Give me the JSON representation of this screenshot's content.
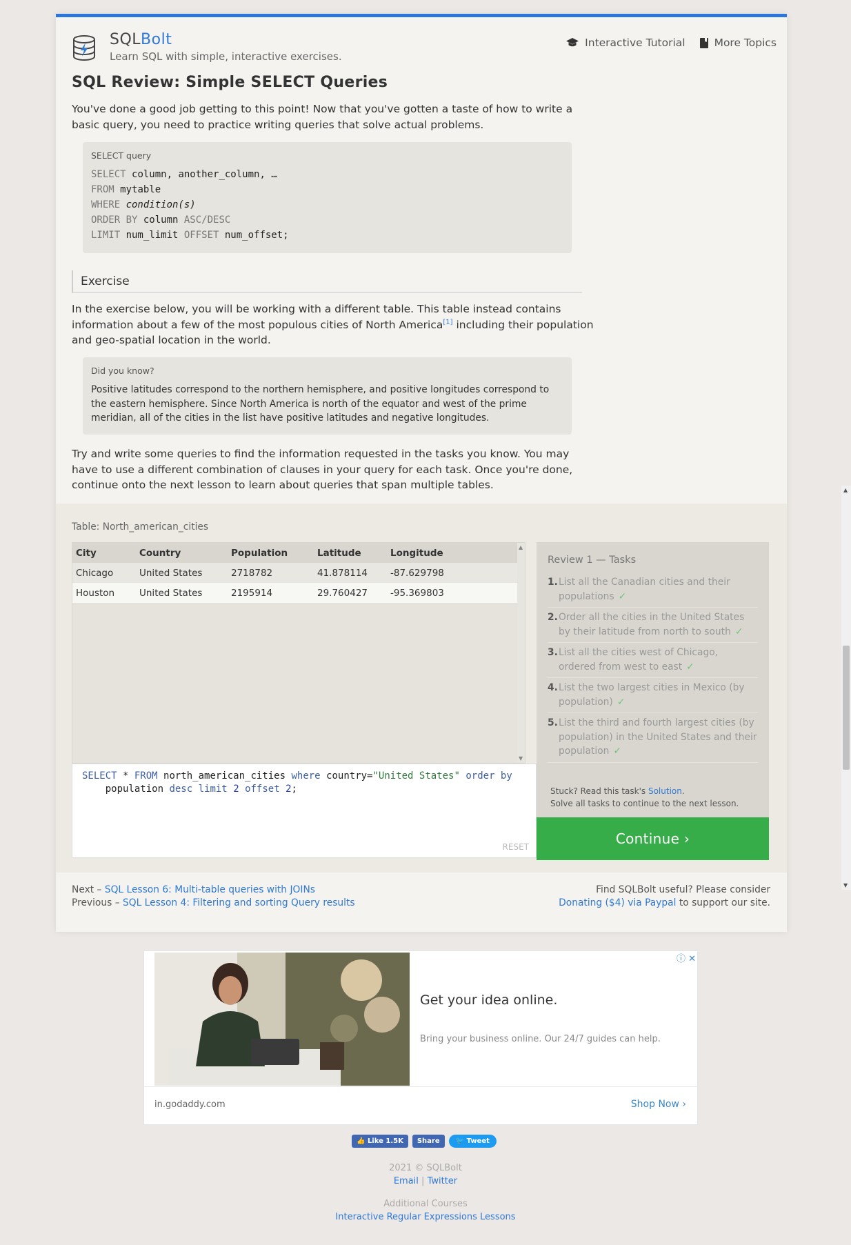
{
  "header": {
    "brand_prefix": "SQL",
    "brand_suffix": "Bolt",
    "tagline": "Learn SQL with simple, interactive exercises.",
    "nav": [
      {
        "label": "Interactive Tutorial",
        "icon": "graduation-cap-icon"
      },
      {
        "label": "More Topics",
        "icon": "bookmark-icon"
      }
    ]
  },
  "lesson": {
    "title": "SQL Review: Simple SELECT Queries",
    "intro": "You've done a good job getting to this point! Now that you've gotten a taste of how to write a basic query, you need to practice writing queries that solve actual problems.",
    "query_box_label": "SELECT query",
    "query_lines": [
      {
        "kw": "SELECT ",
        "rest": "column, another_column, …"
      },
      {
        "kw": "FROM ",
        "rest": "mytable"
      },
      {
        "kw": "WHERE ",
        "rest": "condition(s)"
      },
      {
        "kw": "ORDER BY ",
        "rest": "column",
        "kw2": " ASC/DESC"
      },
      {
        "kw": "LIMIT ",
        "rest": "num_limit",
        "kw2": " OFFSET ",
        "rest2": "num_offset;"
      }
    ],
    "exercise_heading": "Exercise",
    "exercise_p1": "In the exercise below, you will be working with a different table. This table instead contains information about a few of the most populous cities of North America",
    "exercise_ref": "[1]",
    "exercise_p2": " including their population and geo-spatial location in the world.",
    "dyk_label": "Did you know?",
    "dyk_text": "Positive latitudes correspond to the northern hemisphere, and positive longitudes correspond to the eastern hemisphere. Since North America is north of the equator and west of the prime meridian, all of the cities in the list have positive latitudes and negative longitudes.",
    "try_text": "Try and write some queries to find the information requested in the tasks you know. You may have to use a different combination of clauses in your query for each task. Once you're done, continue onto the next lesson to learn about queries that span multiple tables."
  },
  "exercise": {
    "table_label": "Table: North_american_cities",
    "columns": [
      "City",
      "Country",
      "Population",
      "Latitude",
      "Longitude"
    ],
    "rows": [
      [
        "Chicago",
        "United States",
        "2718782",
        "41.878114",
        "-87.629798"
      ],
      [
        "Houston",
        "United States",
        "2195914",
        "29.760427",
        "-95.369803"
      ]
    ],
    "query_tokens_line1": [
      {
        "t": "SELECT",
        "c": "sk"
      },
      {
        "t": " * ",
        "c": ""
      },
      {
        "t": "FROM",
        "c": "sk"
      },
      {
        "t": " north_american_cities ",
        "c": ""
      },
      {
        "t": "where",
        "c": "sk"
      },
      {
        "t": " country=",
        "c": ""
      },
      {
        "t": "\"United States\"",
        "c": "sstr"
      },
      {
        "t": " ",
        "c": ""
      },
      {
        "t": "order by",
        "c": "sk"
      }
    ],
    "query_tokens_line2": [
      {
        "t": "    population ",
        "c": ""
      },
      {
        "t": "desc",
        "c": "sk"
      },
      {
        "t": " ",
        "c": ""
      },
      {
        "t": "limit",
        "c": "sk"
      },
      {
        "t": " ",
        "c": ""
      },
      {
        "t": "2",
        "c": "snum"
      },
      {
        "t": " ",
        "c": ""
      },
      {
        "t": "offset",
        "c": "sk"
      },
      {
        "t": " ",
        "c": ""
      },
      {
        "t": "2",
        "c": "snum"
      },
      {
        "t": ";",
        "c": ""
      }
    ],
    "reset_label": "RESET",
    "tasks_title": "Review 1 — Tasks",
    "tasks": [
      "List all the Canadian cities and their populations",
      "Order all the cities in the United States by their latitude from north to south",
      "List all the cities west of Chicago, ordered from west to east",
      "List the two largest cities in Mexico (by population)",
      "List the third and fourth largest cities (by population) in the United States and their population"
    ],
    "check_mark": "✓",
    "stuck_prefix": "Stuck? Read this task's ",
    "stuck_link": "Solution",
    "stuck_suffix": ".",
    "solve_all": "Solve all tasks to continue to the next lesson.",
    "continue_label": "Continue ›"
  },
  "lesson_nav": {
    "next_prefix": "Next – ",
    "next_link": "SQL Lesson 6: Multi-table queries with JOINs",
    "prev_prefix": "Previous – ",
    "prev_link": "SQL Lesson 4: Filtering and sorting Query results",
    "support_line1": "Find SQLBolt useful? Please consider",
    "support_link": "Donating ($4) via Paypal",
    "support_suffix": " to support our site."
  },
  "ad": {
    "title": "Get your idea online.",
    "subtitle": "Bring your business online. Our 24/7 guides can help.",
    "domain": "in.godaddy.com",
    "cta": "Shop Now"
  },
  "social": {
    "like": "Like 1.5K",
    "share": "Share",
    "tweet": "Tweet"
  },
  "footer": {
    "copyright": "2021 © SQLBolt",
    "email": "Email",
    "sep": "|",
    "twitter": "Twitter",
    "additional": "Additional Courses",
    "regex": "Interactive Regular Expressions Lessons"
  },
  "colors": {
    "accent": "#2b76d8",
    "continue": "#36ad48",
    "check": "#6fc47a"
  }
}
